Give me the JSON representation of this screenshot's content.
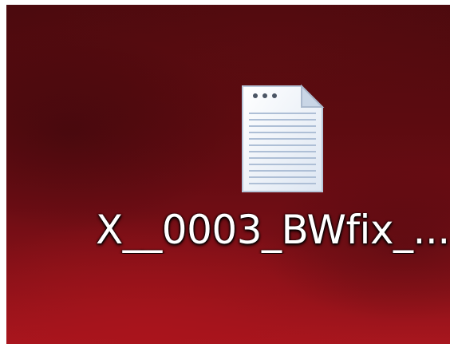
{
  "desktop": {
    "icons": [
      {
        "type": "text-document",
        "icon": "text-file-icon",
        "label": "X__0003_BWfix_..."
      }
    ]
  },
  "colors": {
    "wallpaper_dark": "#4a0a0e",
    "wallpaper_light": "#a8161e",
    "label_text": "#ffffff"
  }
}
